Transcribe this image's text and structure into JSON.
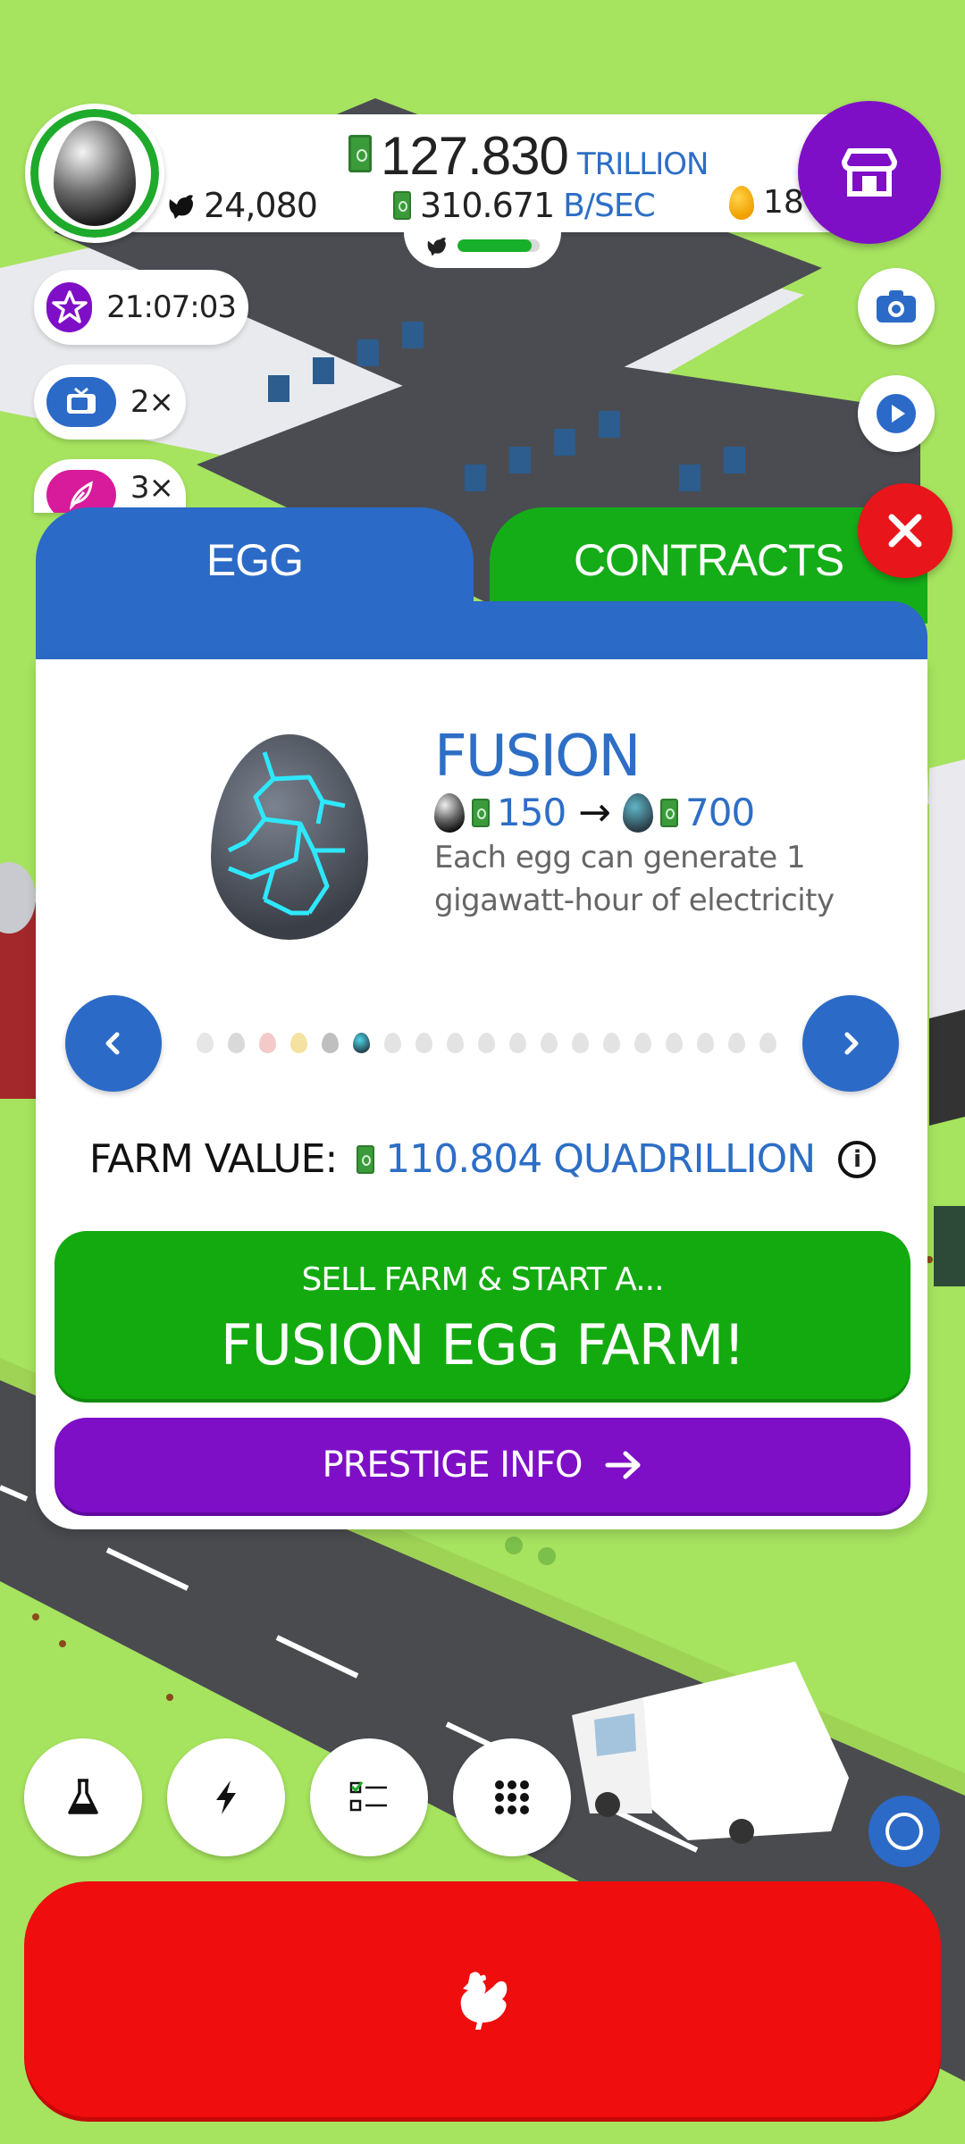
{
  "hud": {
    "money_amount": "127.830",
    "money_unit": "TRILLION",
    "rate_amount": "310.671",
    "rate_unit": "B/SEC",
    "chicken_count": "24,080",
    "golden_eggs": "18",
    "habitat_fill_fraction": 0.9
  },
  "boosts": [
    {
      "icon": "star-icon",
      "text": "21:07:03",
      "color": "#7e0fc7"
    },
    {
      "icon": "tv-icon",
      "text": "2×",
      "color": "#2b6ac7"
    },
    {
      "icon": "feather-icon",
      "text": "3×",
      "color": "#d81b9a"
    }
  ],
  "tabs": {
    "egg": "EGG",
    "contracts": "CONTRACTS"
  },
  "egg_info": {
    "name": "FUSION",
    "from_value": "150",
    "to_value": "700",
    "description": "Each egg can generate 1 gigawatt-hour of electricity"
  },
  "egg_carousel": {
    "total": 19,
    "selected_index": 5
  },
  "farm_value": {
    "label": "FARM VALUE:",
    "value": "110.804 QUADRILLION"
  },
  "sell_button": {
    "top_line": "SELL FARM & START A...",
    "main_line": "FUSION EGG FARM!"
  },
  "prestige_button": {
    "label": "PRESTIGE INFO"
  },
  "colors": {
    "accent_blue": "#2b6ac7",
    "green": "#13aa10",
    "purple": "#7e0fc7",
    "red": "#ef0d0d",
    "background": "#a6e35f"
  },
  "tool_icons": [
    "research-flask-icon",
    "boost-lightning-icon",
    "missions-checklist-icon",
    "menu-grid-icon"
  ]
}
